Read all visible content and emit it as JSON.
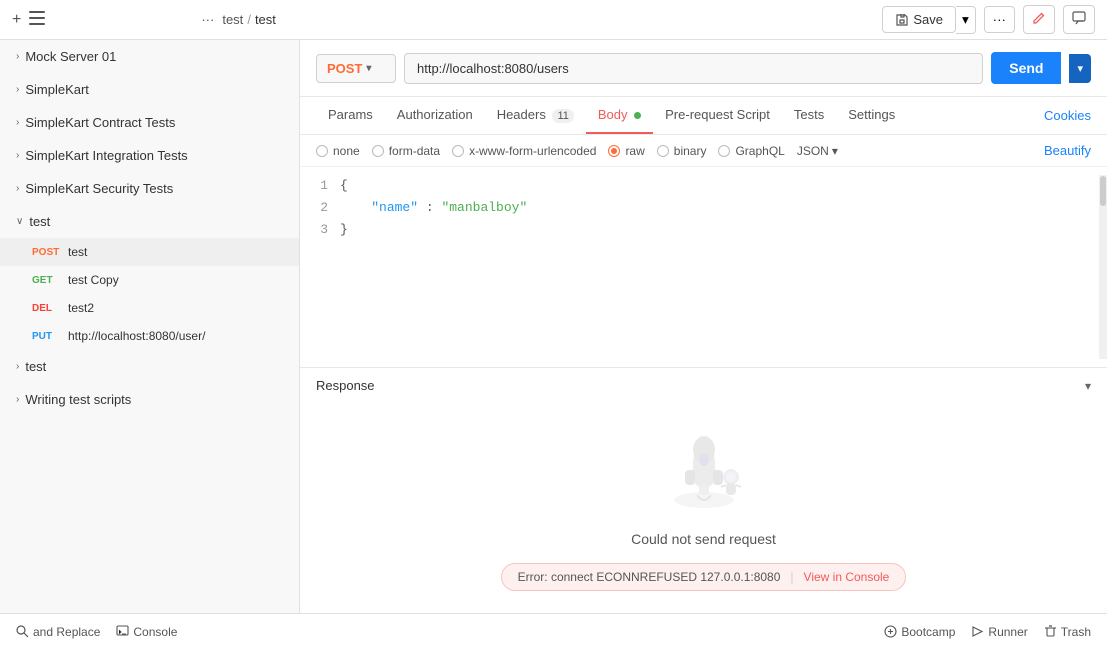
{
  "topbar": {
    "plus_label": "+",
    "tab_more": "···",
    "breadcrumb_parent": "test",
    "breadcrumb_sep": "/",
    "breadcrumb_current": "test",
    "save_label": "Save",
    "edit_icon": "✎",
    "comment_icon": "💬"
  },
  "sidebar": {
    "items": [
      {
        "id": "mock-server",
        "label": "Mock Server 01",
        "arrow": "›",
        "collapsed": true
      },
      {
        "id": "simplekart",
        "label": "SimpleKart",
        "arrow": "›",
        "collapsed": true
      },
      {
        "id": "simplekart-contract",
        "label": "SimpleKart Contract Tests",
        "arrow": "›",
        "collapsed": true
      },
      {
        "id": "simplekart-integration",
        "label": "SimpleKart Integration Tests",
        "arrow": "›",
        "collapsed": true
      },
      {
        "id": "simplekart-security",
        "label": "SimpleKart Security Tests",
        "arrow": "›",
        "collapsed": true
      },
      {
        "id": "test-expanded",
        "label": "test",
        "arrow": "∨",
        "collapsed": false
      }
    ],
    "test_children": [
      {
        "method": "POST",
        "method_class": "method-post",
        "label": "test",
        "selected": true
      },
      {
        "method": "GET",
        "method_class": "method-get",
        "label": "test Copy"
      },
      {
        "method": "DEL",
        "method_class": "method-del",
        "label": "test2"
      },
      {
        "method": "PUT",
        "method_class": "method-put",
        "label": "http://localhost:8080/user/"
      }
    ],
    "extra_items": [
      {
        "id": "test2",
        "label": "test",
        "arrow": "›",
        "collapsed": true
      },
      {
        "id": "writing-test-scripts",
        "label": "Writing test scripts",
        "arrow": "›",
        "collapsed": true
      }
    ]
  },
  "request": {
    "method": "POST",
    "method_arrow": "▾",
    "url": "http://localhost:8080/users",
    "send_label": "Send",
    "send_arrow": "▾"
  },
  "tabs": {
    "items": [
      {
        "id": "params",
        "label": "Params",
        "active": false
      },
      {
        "id": "authorization",
        "label": "Authorization",
        "active": false
      },
      {
        "id": "headers",
        "label": "Headers",
        "badge": "11",
        "active": false
      },
      {
        "id": "body",
        "label": "Body",
        "active": true,
        "dot": true
      },
      {
        "id": "pre-request",
        "label": "Pre-request Script",
        "active": false
      },
      {
        "id": "tests",
        "label": "Tests",
        "active": false
      },
      {
        "id": "settings",
        "label": "Settings",
        "active": false
      }
    ],
    "cookies_label": "Cookies",
    "beautify_label": "Beautify"
  },
  "body_options": {
    "options": [
      {
        "id": "none",
        "label": "none",
        "checked": false
      },
      {
        "id": "form-data",
        "label": "form-data",
        "checked": false
      },
      {
        "id": "urlencoded",
        "label": "x-www-form-urlencoded",
        "checked": false
      },
      {
        "id": "raw",
        "label": "raw",
        "checked": true,
        "color": "orange"
      },
      {
        "id": "binary",
        "label": "binary",
        "checked": false
      },
      {
        "id": "graphql",
        "label": "GraphQL",
        "checked": false
      }
    ],
    "json_label": "JSON",
    "json_arrow": "▾"
  },
  "code": {
    "lines": [
      {
        "num": 1,
        "content": "{",
        "type": "brace"
      },
      {
        "num": 2,
        "content": "    \"name\" : \"manbalboy\"",
        "type": "keyvalue",
        "key": "\"name\"",
        "colon": " : ",
        "value": "\"manbalboy\"",
        "indent": "    "
      },
      {
        "num": 3,
        "content": "}",
        "type": "brace"
      }
    ]
  },
  "response": {
    "label": "Response",
    "arrow": "▾",
    "empty_msg": "Could not send request",
    "error_text": "Error: connect ECONNREFUSED 127.0.0.1:8080",
    "error_sep": "|",
    "view_console": "View in Console"
  },
  "footer": {
    "find_replace": "and Replace",
    "console": "Console",
    "bootcamp": "Bootcamp",
    "runner": "Runner",
    "trash": "Trash"
  }
}
